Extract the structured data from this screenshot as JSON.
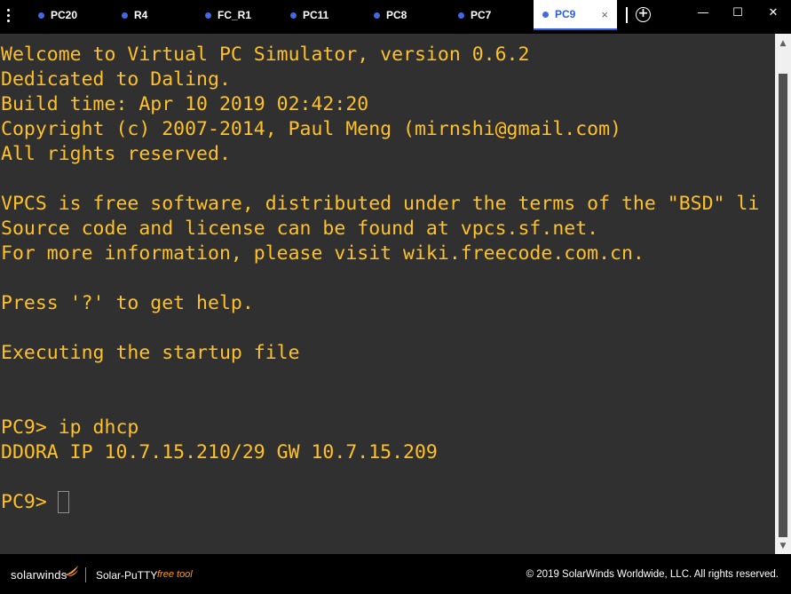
{
  "tabs": [
    {
      "label": "PC20",
      "active": false
    },
    {
      "label": "R4",
      "active": false
    },
    {
      "label": "FC_R1",
      "active": false
    },
    {
      "label": "PC11",
      "active": false
    },
    {
      "label": "PC8",
      "active": false
    },
    {
      "label": "PC7",
      "active": false
    },
    {
      "label": "PC9",
      "active": true
    }
  ],
  "tab_close_glyph": "×",
  "add_tab_glyph": "+",
  "window_controls": {
    "minimize": "—",
    "maximize": "☐",
    "close": "✕"
  },
  "terminal": {
    "lines": [
      "Welcome to Virtual PC Simulator, version 0.6.2",
      "Dedicated to Daling.",
      "Build time: Apr 10 2019 02:42:20",
      "Copyright (c) 2007-2014, Paul Meng (mirnshi@gmail.com)",
      "All rights reserved.",
      "",
      "VPCS is free software, distributed under the terms of the \"BSD\" li",
      "Source code and license can be found at vpcs.sf.net.",
      "For more information, please visit wiki.freecode.com.cn.",
      "",
      "Press '?' to get help.",
      "",
      "Executing the startup file",
      "",
      "",
      "PC9> ip dhcp",
      "DDORA IP 10.7.15.210/29 GW 10.7.15.209",
      "",
      "PC9> "
    ],
    "text_color": "#ffc125",
    "background": "#303030",
    "cursor_color": "#2bd62b"
  },
  "footer": {
    "logo": "solarwinds",
    "product": "Solar-PuTTY",
    "free_tool": "free tool",
    "copyright": "© 2019 SolarWinds Worldwide, LLC. All rights reserved."
  },
  "colors": {
    "accent": "#2e5ce6",
    "tab_dot": "#4169e1",
    "brand_orange": "#ff9c1a"
  }
}
